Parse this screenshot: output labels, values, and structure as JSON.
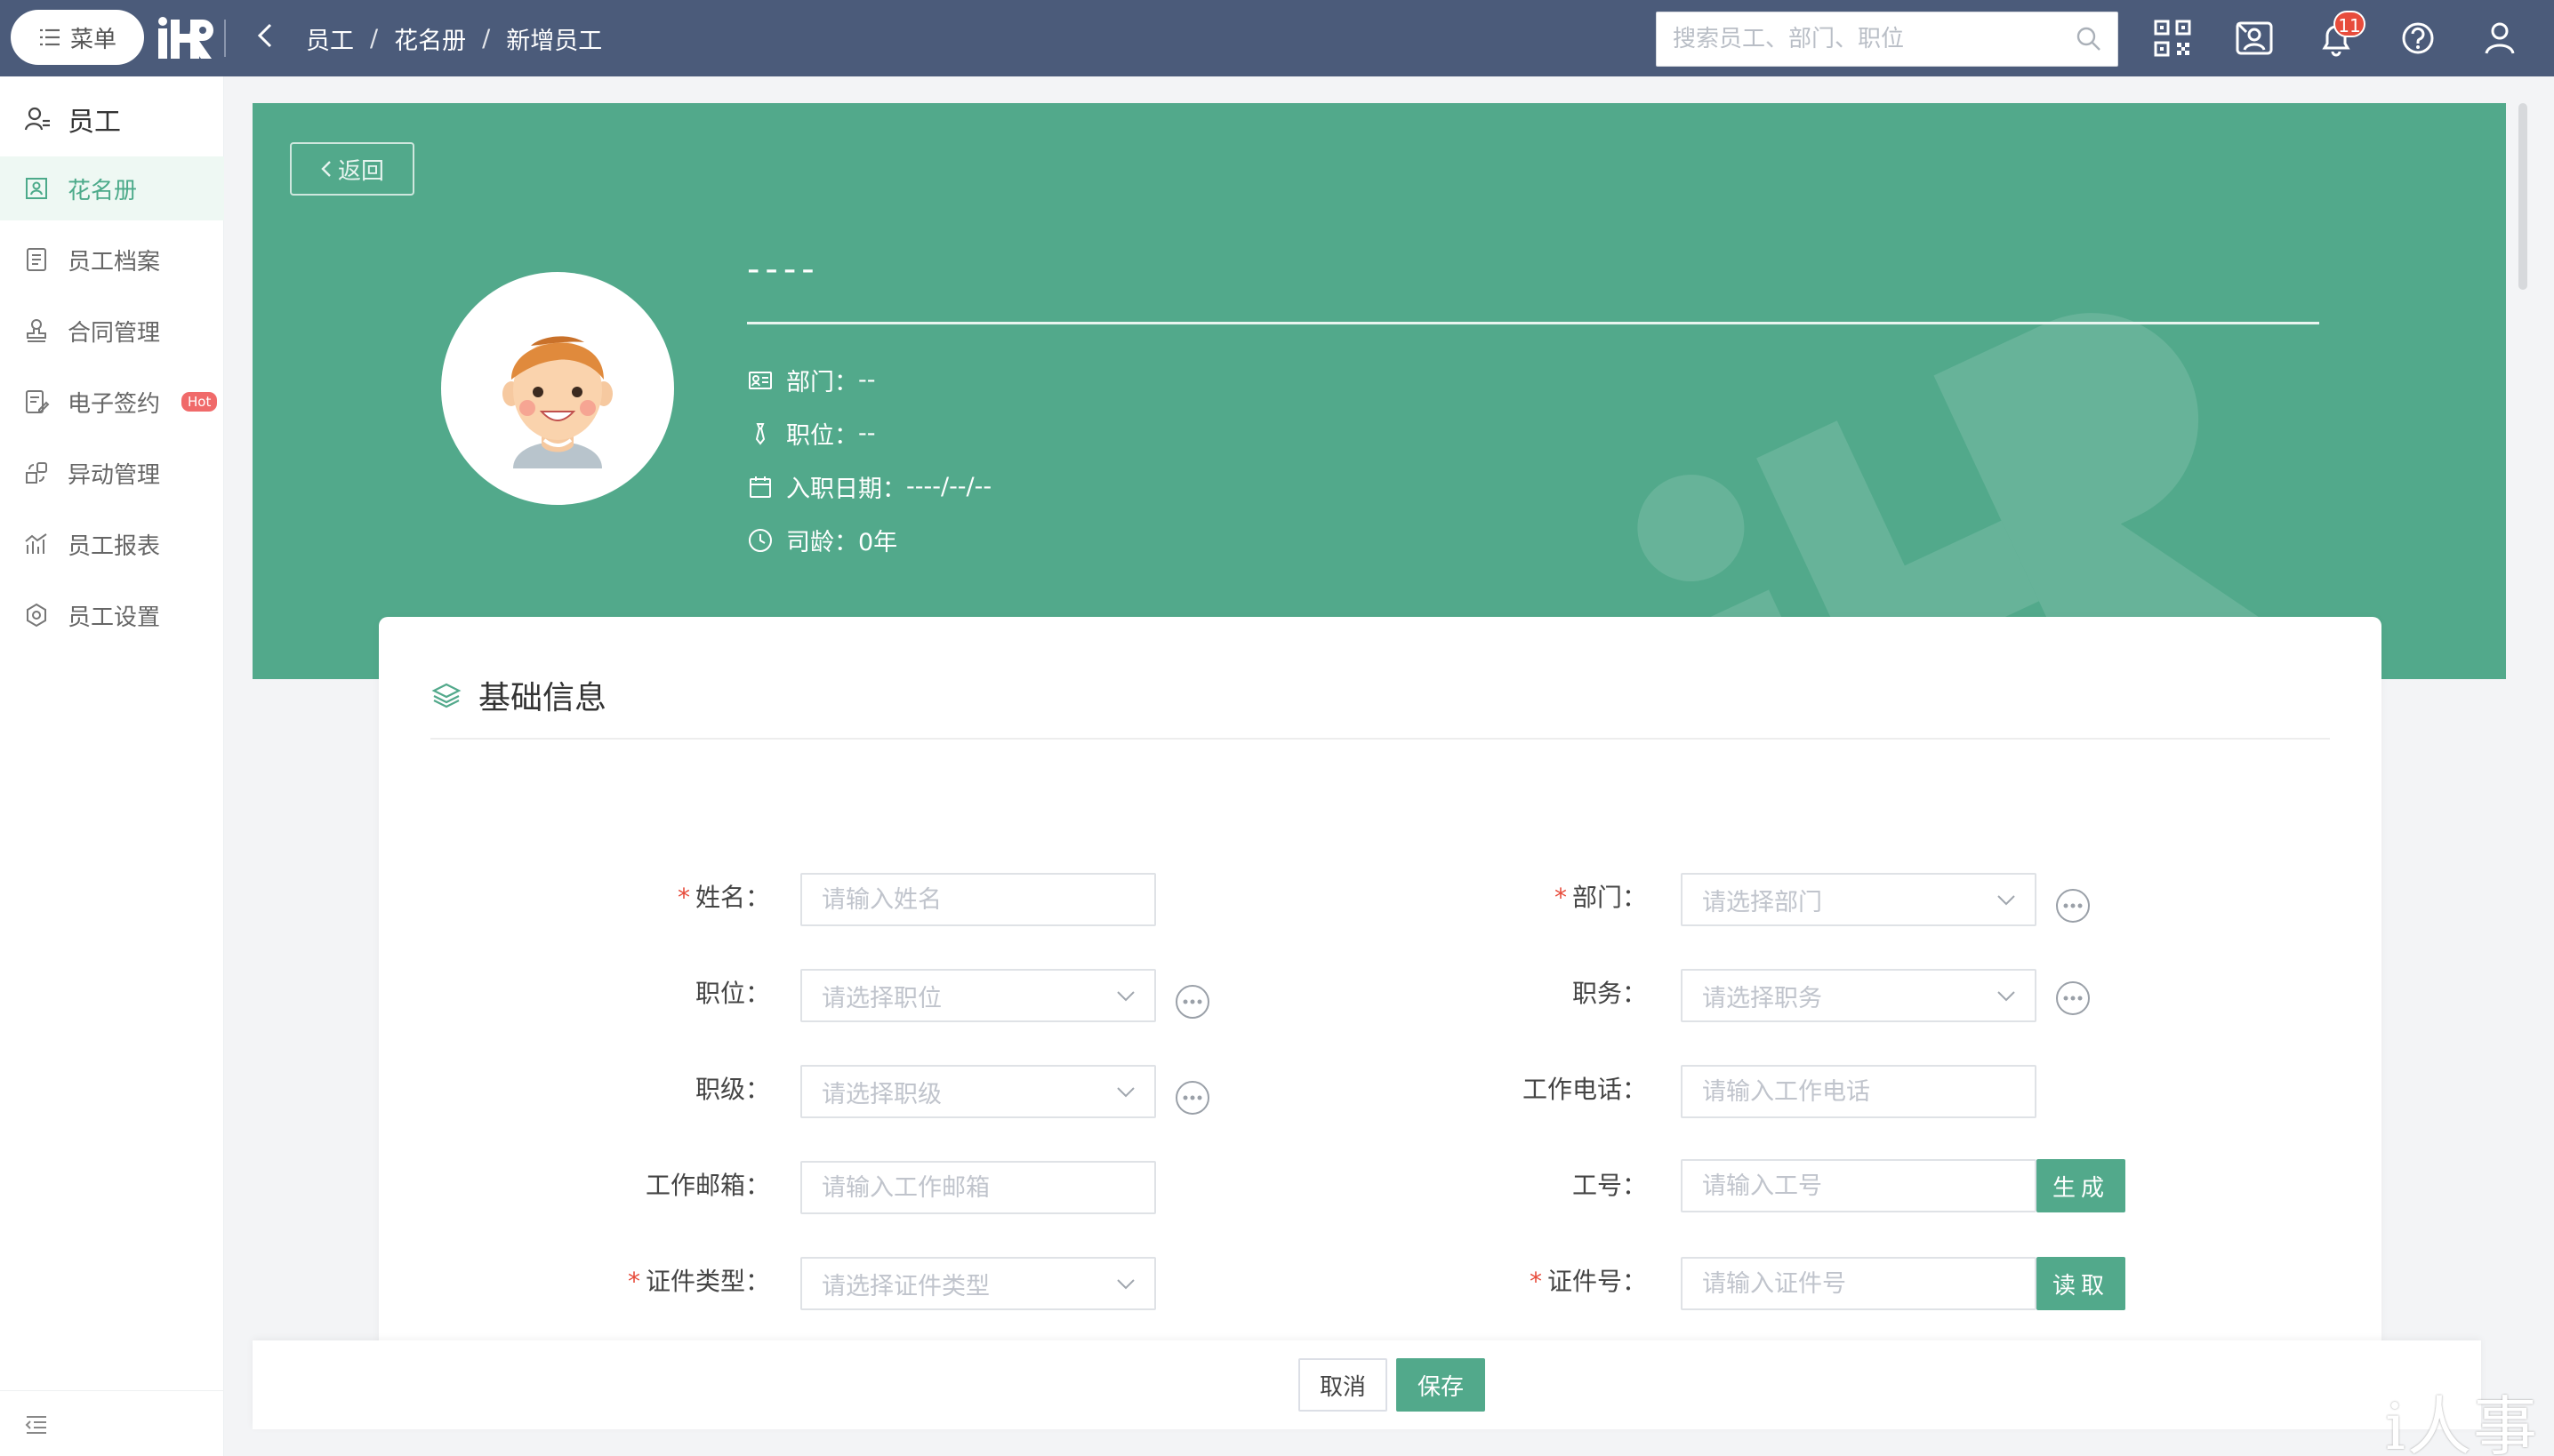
{
  "topbar": {
    "menu_label": "菜单",
    "breadcrumb": [
      "员工",
      "花名册",
      "新增员工"
    ],
    "breadcrumb_sep": "/",
    "search_placeholder": "搜索员工、部门、职位",
    "notification_count": "11"
  },
  "sidebar": {
    "header": "员工",
    "items": [
      {
        "label": "花名册",
        "icon": "roster-icon",
        "active": true
      },
      {
        "label": "员工档案",
        "icon": "file-icon"
      },
      {
        "label": "合同管理",
        "icon": "stamp-icon"
      },
      {
        "label": "电子签约",
        "icon": "esign-icon",
        "badge": "Hot"
      },
      {
        "label": "异动管理",
        "icon": "transfer-icon"
      },
      {
        "label": "员工报表",
        "icon": "chart-icon"
      },
      {
        "label": "员工设置",
        "icon": "settings-icon"
      }
    ]
  },
  "banner": {
    "back_label": "返回",
    "name": "----",
    "department_label": "部门：",
    "department_value": "--",
    "position_label": "职位：",
    "position_value": "--",
    "hire_date_label": "入职日期：",
    "hire_date_value": "----/--/--",
    "tenure_label": "司龄：",
    "tenure_value": "0年"
  },
  "form": {
    "section_title": "基础信息",
    "fields": {
      "name": {
        "label": "姓名：",
        "placeholder": "请输入姓名"
      },
      "department": {
        "label": "部门：",
        "placeholder": "请选择部门"
      },
      "position": {
        "label": "职位：",
        "placeholder": "请选择职位"
      },
      "duty": {
        "label": "职务：",
        "placeholder": "请选择职务"
      },
      "rank": {
        "label": "职级：",
        "placeholder": "请选择职级"
      },
      "work_phone": {
        "label": "工作电话：",
        "placeholder": "请输入工作电话"
      },
      "work_email": {
        "label": "工作邮箱：",
        "placeholder": "请输入工作邮箱"
      },
      "employee_no": {
        "label": "工号：",
        "placeholder": "请输入工号",
        "button": "生成"
      },
      "id_type": {
        "label": "证件类型：",
        "placeholder": "请选择证件类型"
      },
      "id_no": {
        "label": "证件号：",
        "placeholder": "请输入证件号",
        "button": "读取"
      }
    },
    "required_mark": "*"
  },
  "footer": {
    "cancel_label": "取消",
    "save_label": "保存"
  },
  "brand": "i人事",
  "colors": {
    "topbar": "#4b5b7a",
    "accent": "#52a98b",
    "required": "#e74c3c"
  }
}
